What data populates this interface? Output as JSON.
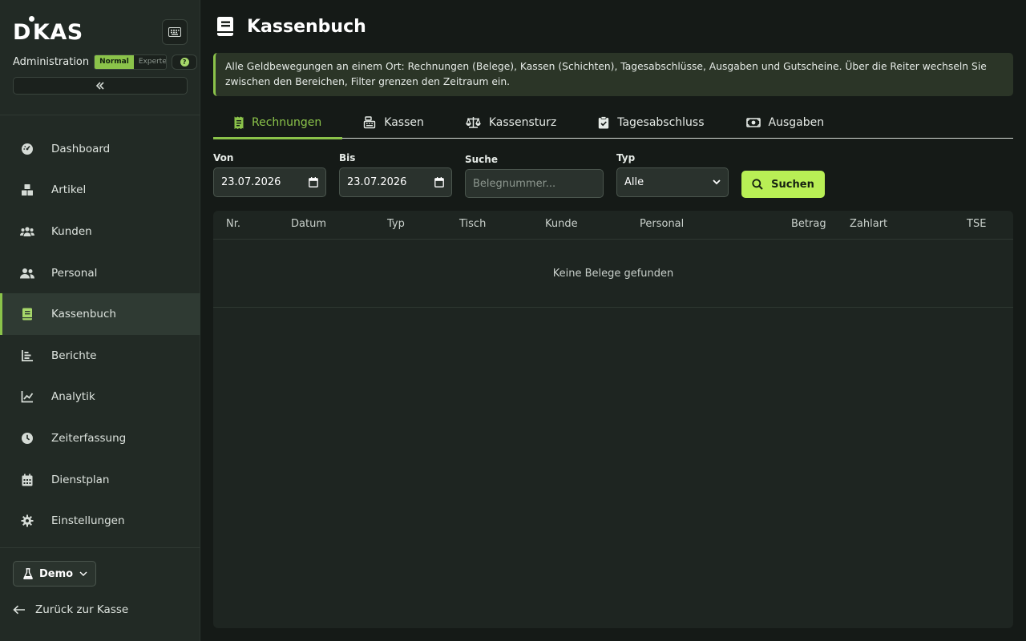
{
  "brand": {
    "logo_text": "DKAS"
  },
  "header_row": {
    "admin_label": "Administration",
    "mode_normal": "Normal",
    "mode_expert": "Experte",
    "help_glyph": "?"
  },
  "nav": {
    "items": [
      {
        "label": "Dashboard",
        "icon": "dashboard-icon"
      },
      {
        "label": "Artikel",
        "icon": "boxes-icon"
      },
      {
        "label": "Kunden",
        "icon": "users-icon"
      },
      {
        "label": "Personal",
        "icon": "user-group-icon"
      },
      {
        "label": "Kassenbuch",
        "icon": "book-icon",
        "active": true
      },
      {
        "label": "Berichte",
        "icon": "bar-chart-icon"
      },
      {
        "label": "Analytik",
        "icon": "line-chart-icon"
      },
      {
        "label": "Zeiterfassung",
        "icon": "clock-icon"
      },
      {
        "label": "Dienstplan",
        "icon": "calendar-icon"
      },
      {
        "label": "Einstellungen",
        "icon": "gear-icon"
      }
    ]
  },
  "footer": {
    "demo_label": "Demo",
    "back_label": "Zurück zur Kasse"
  },
  "page": {
    "title": "Kassenbuch",
    "info_text": "Alle Geldbewegungen an einem Ort: Rechnungen (Belege), Kassen (Schichten), Tagesabschlüsse, Ausgaben und Gutscheine. Über die Reiter wechseln Sie zwischen den Bereichen, Filter grenzen den Zeitraum ein."
  },
  "tabs": [
    {
      "label": "Rechnungen",
      "icon": "receipt-icon",
      "active": true
    },
    {
      "label": "Kassen",
      "icon": "cash-register-icon"
    },
    {
      "label": "Kassensturz",
      "icon": "scale-icon"
    },
    {
      "label": "Tagesabschluss",
      "icon": "clipboard-check-icon"
    },
    {
      "label": "Ausgaben",
      "icon": "money-bill-icon"
    }
  ],
  "filters": {
    "von_label": "Von",
    "von_value": "23.07.2026",
    "bis_label": "Bis",
    "bis_value": "23.07.2026",
    "suche_label": "Suche",
    "suche_placeholder": "Belegnummer...",
    "typ_label": "Typ",
    "typ_value": "Alle",
    "search_button": "Suchen"
  },
  "table": {
    "columns": [
      "Nr.",
      "Datum",
      "Typ",
      "Tisch",
      "Kunde",
      "Personal",
      "Betrag",
      "Zahlart",
      "TSE"
    ],
    "empty_text": "Keine Belege gefunden"
  },
  "colors": {
    "accent": "#8bc34a",
    "button": "#b8ef55",
    "sidebar_bg": "#222a25",
    "page_bg": "#151a17"
  }
}
